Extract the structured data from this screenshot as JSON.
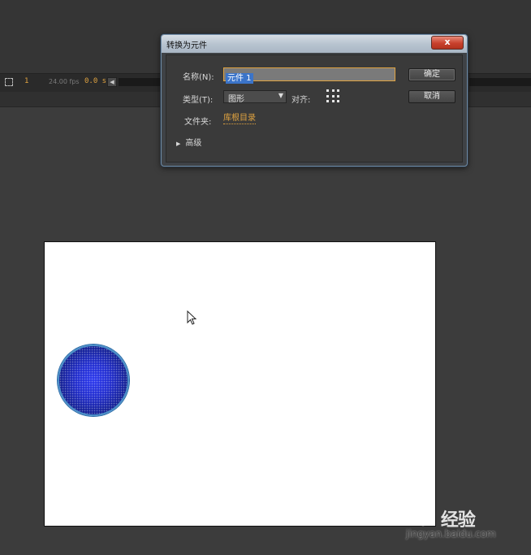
{
  "timeline": {
    "frame": "1",
    "fps": "24.00 fps",
    "time": "0.0 s",
    "scroll_left_glyph": "◀"
  },
  "dialog": {
    "title": "转换为元件",
    "close_glyph": "x",
    "name_label": "名称(N):",
    "name_value": "元件 1",
    "type_label": "类型(T):",
    "type_value": "图形",
    "type_arrow": "▼",
    "align_label": "对齐:",
    "folder_label": "文件夹:",
    "folder_value": "库根目录",
    "advanced_label": "高级",
    "advanced_glyph": "▶",
    "ok_label": "确定",
    "cancel_label": "取消"
  },
  "stage": {
    "shape_fill": "#2430d0",
    "shape_stroke": "#4a8ec8"
  },
  "watermark": {
    "brand": "Bai 经验",
    "url": "jingyan.baidu.com"
  },
  "icons": {
    "cursor": "arrow-cursor-icon",
    "align": "registration-grid-icon",
    "timeline": "center-frame-icon"
  }
}
